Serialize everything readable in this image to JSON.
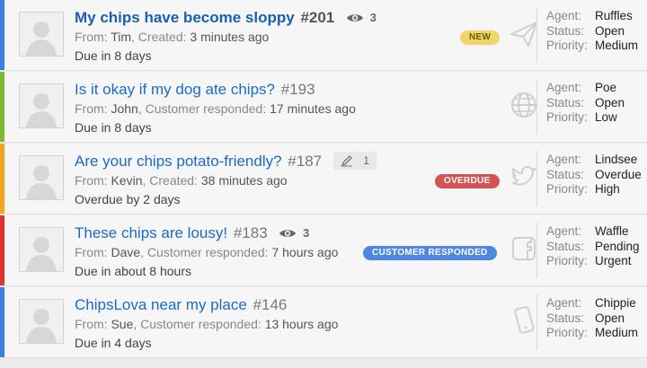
{
  "tickets": [
    {
      "title": "My chips have become sloppy",
      "number": "#201",
      "views": "3",
      "notes": "",
      "from_label": "From:",
      "from": "Tim",
      "activity_label": "Created:",
      "activity_time": "3 minutes ago",
      "due": "Due in 8 days",
      "badge": "NEW",
      "stripe_color": "#3b7fe0",
      "channel_icon": "paper-plane-icon",
      "agent": "Ruffles",
      "status": "Open",
      "priority": "Medium"
    },
    {
      "title": "Is it okay if my dog ate chips?",
      "number": "#193",
      "views": "",
      "notes": "",
      "from_label": "From:",
      "from": "John",
      "activity_label": "Customer responded:",
      "activity_time": "17 minutes ago",
      "due": "Due in 8 days",
      "badge": "",
      "stripe_color": "#7cbb2f",
      "channel_icon": "globe-icon",
      "agent": "Poe",
      "status": "Open",
      "priority": "Low"
    },
    {
      "title": "Are your chips potato-friendly?",
      "number": "#187",
      "views": "",
      "notes": "1",
      "from_label": "From:",
      "from": "Kevin",
      "activity_label": "Created:",
      "activity_time": "38 minutes ago",
      "due": "Overdue by 2 days",
      "badge": "OVERDUE",
      "stripe_color": "#f3a51d",
      "channel_icon": "twitter-bird-icon",
      "agent": "Lindsee",
      "status": "Overdue",
      "priority": "High"
    },
    {
      "title": "These chips are lousy!",
      "number": "#183",
      "views": "3",
      "notes": "",
      "from_label": "From:",
      "from": "Dave",
      "activity_label": "Customer responded:",
      "activity_time": "7 hours ago",
      "due": "Due in about 8 hours",
      "badge": "CUSTOMER RESPONDED",
      "stripe_color": "#e0332f",
      "channel_icon": "facebook-icon",
      "agent": "Waffle",
      "status": "Pending",
      "priority": "Urgent"
    },
    {
      "title": "ChipsLova near my place",
      "number": "#146",
      "views": "",
      "notes": "",
      "from_label": "From:",
      "from": "Sue",
      "activity_label": "Customer responded:",
      "activity_time": "13 hours ago",
      "due": "Due in 4 days",
      "badge": "",
      "stripe_color": "#3b7fe0",
      "channel_icon": "mobile-phone-icon",
      "agent": "Chippie",
      "status": "Open",
      "priority": "Medium"
    }
  ],
  "labels": {
    "agent": "Agent:",
    "status": "Status:",
    "priority": "Priority:"
  }
}
